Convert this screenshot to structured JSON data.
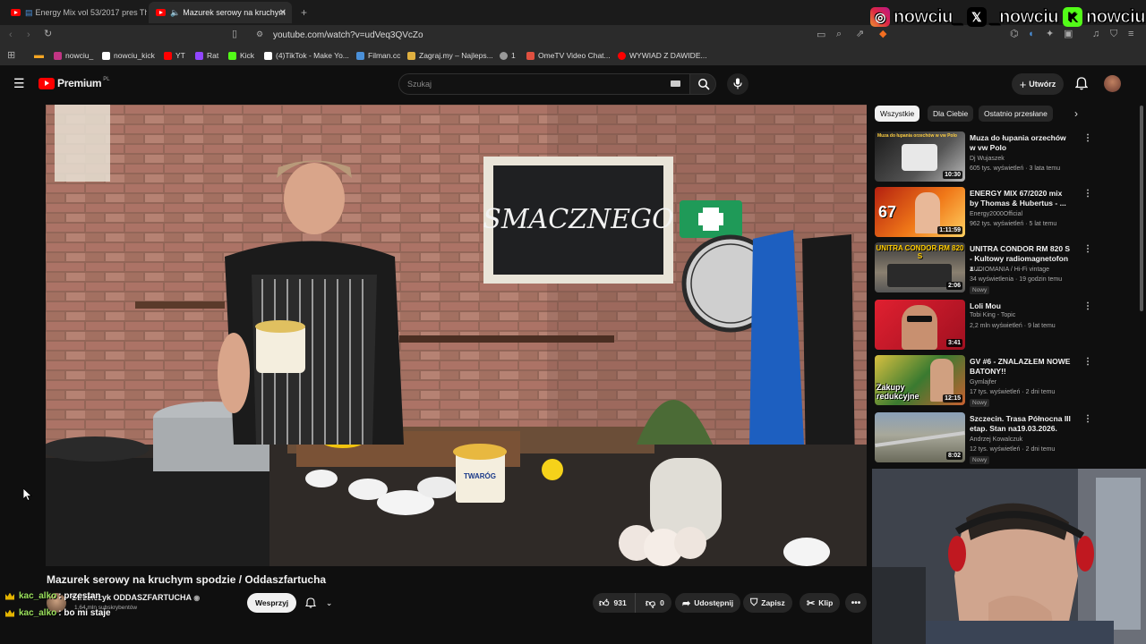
{
  "browser": {
    "tabs": [
      {
        "label": "Energy Mix vol 53/2017 pres Tho"
      },
      {
        "label": "Mazurek serowy na kruchym"
      }
    ],
    "url": "youtube.com/watch?v=udVeq3QVcZo",
    "bookmarks": [
      {
        "label": "nowciu_",
        "color": "#c13584"
      },
      {
        "label": "nowciu_kick",
        "color": "#ffffff"
      },
      {
        "label": "YT",
        "color": "#ff0000"
      },
      {
        "label": "Rat",
        "color": "#9146ff"
      },
      {
        "label": "Kick",
        "color": "#53fc18"
      },
      {
        "label": "(4)TikTok - Make Yo...",
        "color": "#ffffff"
      },
      {
        "label": "Filman.cc",
        "color": "#4a90d9"
      },
      {
        "label": "Zagraj.my – Najleps...",
        "color": "#e0b040"
      },
      {
        "label": "1",
        "color": "#999999"
      },
      {
        "label": "OmeTV Video Chat...",
        "color": "#e05040"
      },
      {
        "label": "WYWIAD Z DAWIDE...",
        "color": "#ff0000"
      }
    ]
  },
  "socials": [
    {
      "icon": "instagram-icon",
      "label": "nowciu_"
    },
    {
      "icon": "x-icon",
      "label": "_nowciu"
    },
    {
      "icon": "kick-icon",
      "label": "nowciu"
    }
  ],
  "youtube": {
    "logo": "Premium",
    "logo_region": "PL",
    "search_placeholder": "Szukaj",
    "create_label": "Utwórz"
  },
  "chips": [
    "Wszystkie",
    "Dla Ciebie",
    "Ostatnio przesłane"
  ],
  "recommendations": [
    {
      "title": "Muza do łupania orzechów w vw Polo",
      "channel": "Dj Wujaszek",
      "meta": "605 tys. wyświetleń · 3 lata temu",
      "duration": "10:30",
      "badge": ""
    },
    {
      "title": "ENERGY MIX 67/2020 mix by Thomas & Hubertus - ...",
      "channel": "Energy2000Official",
      "meta": "962 tys. wyświetleń · 5 lat temu",
      "duration": "1:11:59",
      "badge": ""
    },
    {
      "title": "UNITRA CONDOR RM 820 S - Kultowy radiomagnetofon z ...",
      "channel": "AUDIOMANIA / Hi-Fi vintage",
      "meta": "34 wyświetlenia · 19 godzin temu",
      "duration": "2:06",
      "badge": "Nowy"
    },
    {
      "title": "Loli Mou",
      "channel": "Tobi King - Topic",
      "meta": "2,2 mln wyświetleń · 9 lat temu",
      "duration": "3:41",
      "badge": ""
    },
    {
      "title": "GV #6 - ZNALAZŁEM NOWE BATONY!!",
      "channel": "Gymlajfer",
      "meta": "17 tys. wyświetleń · 2 dni temu",
      "duration": "12:15",
      "badge": "Nowy"
    },
    {
      "title": "Szczecin. Trasa Północna III etap. Stan na19.03.2026.",
      "channel": "Andrzej Kowalczuk",
      "meta": "12 tys. wyświetleń · 2 dni temu",
      "duration": "8:02",
      "badge": "Nowy"
    }
  ],
  "thumb_text": {
    "t1": "Muza do łupania orzechów w vw Polo",
    "t3": "UNITRA CONDOR RM 820 S",
    "t5": "Zakupy redukcyjne"
  },
  "video": {
    "title": "Mazurek serowy na kruchym spodzie / Oddaszfartucha",
    "channel": "Strzelczyk ODDASZFARTUCHA",
    "subscribers": "1,64 mln subskrybentów",
    "support_label": "Wesprzyj",
    "likes": "931",
    "dislikes": "0",
    "share_label": "Udostępnij",
    "save_label": "Zapisz",
    "clip_label": "Klip",
    "chalkboard": "SMACZNEGO",
    "tub_label": "TWARÓG"
  },
  "chat": [
    {
      "user": "kac_alko",
      "message": ": przestan"
    },
    {
      "user": "kac_alko",
      "message": ": bo mi staje"
    }
  ]
}
